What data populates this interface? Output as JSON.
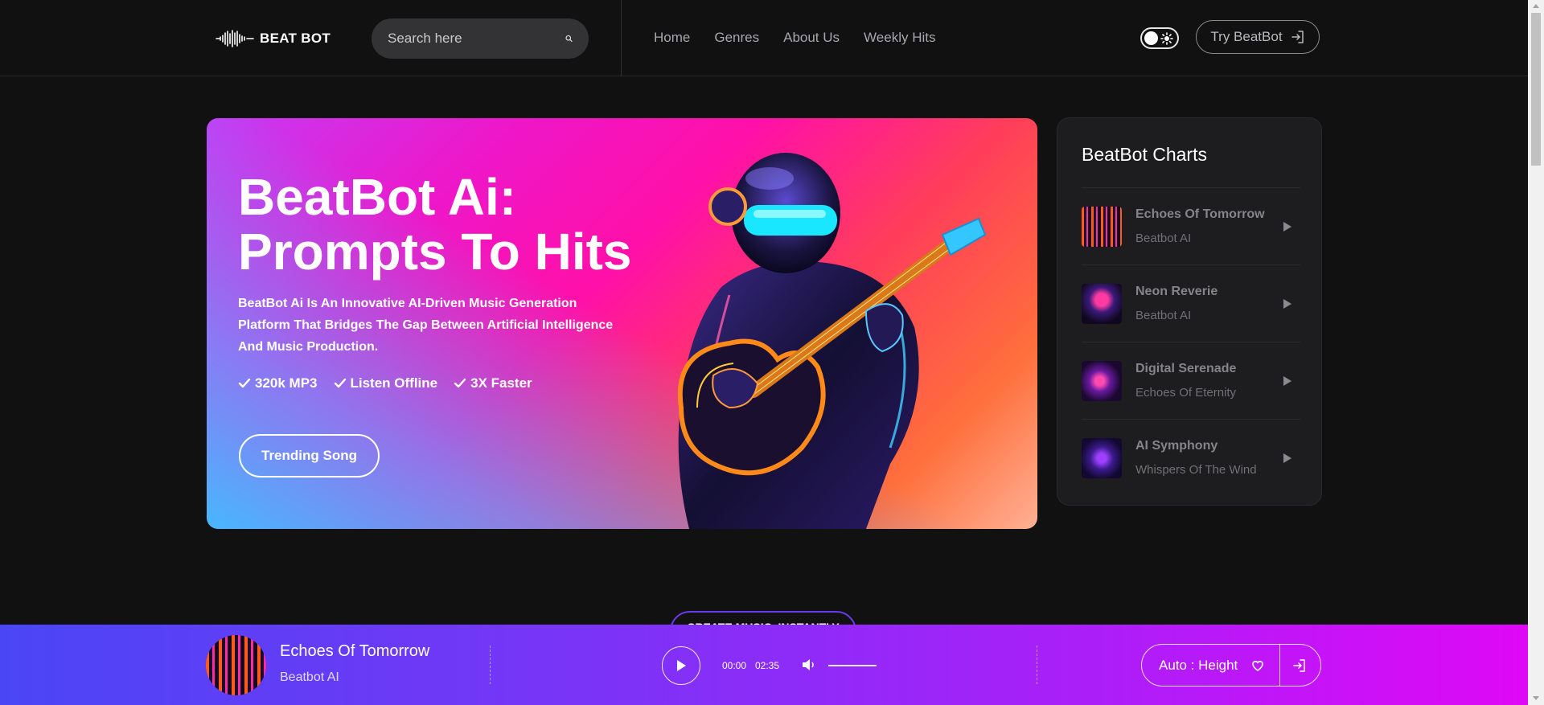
{
  "header": {
    "logo_text": "BEAT BOT",
    "search_placeholder": "Search here",
    "nav": [
      "Home",
      "Genres",
      "About Us",
      "Weekly Hits"
    ],
    "try_label": "Try BeatBot"
  },
  "hero": {
    "title_line1": "BeatBot Ai:",
    "title_line2": "Prompts To Hits",
    "description": "BeatBot Ai Is An Innovative AI-Driven Music Generation Platform That Bridges The Gap Between Artificial Intelligence And Music Production.",
    "features": [
      "320k MP3",
      "Listen Offline",
      "3X Faster"
    ],
    "cta_label": "Trending Song"
  },
  "charts": {
    "title": "BeatBot Charts",
    "items": [
      {
        "name": "Echoes Of Tomorrow",
        "artist": "Beatbot AI"
      },
      {
        "name": "Neon Reverie",
        "artist": "Beatbot AI"
      },
      {
        "name": "Digital Serenade",
        "artist": "Echoes Of Eternity"
      },
      {
        "name": "AI Symphony",
        "artist": "Whispers Of The Wind"
      }
    ]
  },
  "section_pill": "CREATE MUSIC, INSTANTLY",
  "player": {
    "title": "Echoes Of Tomorrow",
    "artist": "Beatbot AI",
    "current_time": "00:00",
    "duration": "02:35",
    "auto_label": "Auto : Height"
  },
  "colors": {
    "background": "#111112",
    "player_gradient_start": "#4a46f6",
    "player_gradient_end": "#df08f6"
  }
}
